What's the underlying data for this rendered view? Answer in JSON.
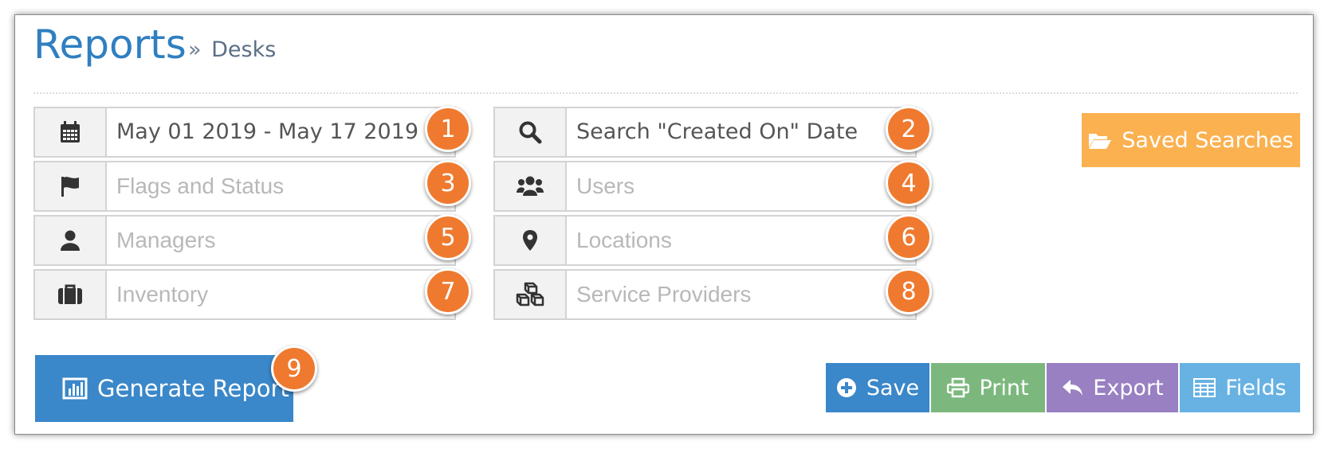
{
  "header": {
    "title": "Reports",
    "breadcrumb_sep": "»",
    "breadcrumb": "Desks"
  },
  "filters": [
    {
      "icon": "calendar-icon",
      "value": "May 01 2019 - May 17 2019",
      "placeholder": "",
      "badge": "1"
    },
    {
      "icon": "search-icon",
      "value": "Search \"Created On\" Date",
      "placeholder": "",
      "badge": "2"
    },
    {
      "icon": "flag-icon",
      "value": "",
      "placeholder": "Flags and Status",
      "badge": "3"
    },
    {
      "icon": "users-icon",
      "value": "",
      "placeholder": "Users",
      "badge": "4"
    },
    {
      "icon": "user-icon",
      "value": "",
      "placeholder": "Managers",
      "badge": "5"
    },
    {
      "icon": "map-marker-icon",
      "value": "",
      "placeholder": "Locations",
      "badge": "6"
    },
    {
      "icon": "briefcase-icon",
      "value": "",
      "placeholder": "Inventory",
      "badge": "7"
    },
    {
      "icon": "cubes-icon",
      "value": "",
      "placeholder": "Service Providers",
      "badge": "8"
    }
  ],
  "saved_searches": {
    "icon": "folder-open-icon",
    "label": "Saved Searches"
  },
  "generate": {
    "icon": "bar-chart-icon",
    "label": "Generate Report",
    "badge": "9"
  },
  "actions": {
    "save": {
      "icon": "plus-circle-icon",
      "label": "Save"
    },
    "print": {
      "icon": "print-icon",
      "label": "Print"
    },
    "export": {
      "icon": "reply-icon",
      "label": "Export"
    },
    "fields": {
      "icon": "table-icon",
      "label": "Fields"
    }
  },
  "colors": {
    "title": "#2f7fc1",
    "badge": "#ef7a2f",
    "saved": "#fbb150",
    "primary": "#3a87c9",
    "print": "#7cb87d",
    "export": "#9880c2",
    "fields": "#67b2e3"
  }
}
